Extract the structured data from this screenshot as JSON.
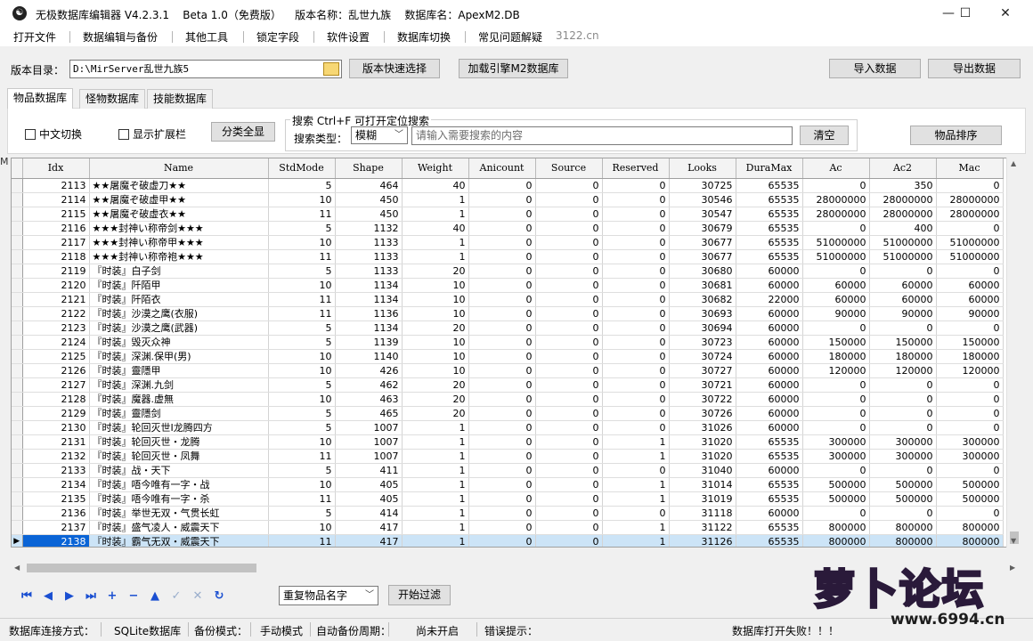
{
  "titlebar": {
    "title": "无极数据库编辑器 V4.2.3.1    Beta 1.0（免费版）    版本名称：乱世九族    数据库名：ApexM2.DB",
    "minimize": "—",
    "maximize": "☐",
    "close": "✕"
  },
  "menu": [
    "打开文件",
    "数据编辑与备份",
    "其他工具",
    "锁定字段",
    "软件设置",
    "数据库切换",
    "常见问题解疑",
    "3122.cn"
  ],
  "toolbar": {
    "version_dir_label": "版本目录：",
    "version_dir_value": "D:\\MirServer乱世九族5",
    "quick_select": "版本快速选择",
    "load_engine_db": "加载引擎M2数据库",
    "import": "导入数据",
    "export": "导出数据"
  },
  "tabs": [
    "物品数据库",
    "怪物数据库",
    "技能数据库"
  ],
  "filters": {
    "chinese_toggle": "中文切换",
    "show_ext": "显示扩展栏",
    "show_all_categories": "分类全显",
    "search_title": "搜索  Ctrl+F 可打开定位搜索",
    "search_type_label": "搜索类型：",
    "search_type_value": "模糊",
    "search_placeholder": "请输入需要搜索的内容",
    "clear": "清空",
    "sort": "物品排序"
  },
  "grid": {
    "columns": [
      "Idx",
      "Name",
      "StdMode",
      "Shape",
      "Weight",
      "Anicount",
      "Source",
      "Reserved",
      "Looks",
      "DuraMax",
      "Ac",
      "Ac2",
      "Mac"
    ],
    "selected_indicator": "▶",
    "rows": [
      [
        "2113",
        "★★屠魔ぞ破虚刀★★",
        "5",
        "464",
        "40",
        "0",
        "0",
        "0",
        "30725",
        "65535",
        "0",
        "350",
        "0"
      ],
      [
        "2114",
        "★★屠魔ぞ破虚甲★★",
        "10",
        "450",
        "1",
        "0",
        "0",
        "0",
        "30546",
        "65535",
        "28000000",
        "28000000",
        "28000000"
      ],
      [
        "2115",
        "★★屠魔ぞ破虚衣★★",
        "11",
        "450",
        "1",
        "0",
        "0",
        "0",
        "30547",
        "65535",
        "28000000",
        "28000000",
        "28000000"
      ],
      [
        "2116",
        "★★★封神い称帝剑★★★",
        "5",
        "1132",
        "40",
        "0",
        "0",
        "0",
        "30679",
        "65535",
        "0",
        "400",
        "0"
      ],
      [
        "2117",
        "★★★封神い称帝甲★★★",
        "10",
        "1133",
        "1",
        "0",
        "0",
        "0",
        "30677",
        "65535",
        "51000000",
        "51000000",
        "51000000"
      ],
      [
        "2118",
        "★★★封神い称帝袍★★★",
        "11",
        "1133",
        "1",
        "0",
        "0",
        "0",
        "30677",
        "65535",
        "51000000",
        "51000000",
        "51000000"
      ],
      [
        "2119",
        "『时装』白子剑",
        "5",
        "1133",
        "20",
        "0",
        "0",
        "0",
        "30680",
        "60000",
        "0",
        "0",
        "0"
      ],
      [
        "2120",
        "『时装』阡陌甲",
        "10",
        "1134",
        "10",
        "0",
        "0",
        "0",
        "30681",
        "60000",
        "60000",
        "60000",
        "60000"
      ],
      [
        "2121",
        "『时装』阡陌衣",
        "11",
        "1134",
        "10",
        "0",
        "0",
        "0",
        "30682",
        "22000",
        "60000",
        "60000",
        "60000"
      ],
      [
        "2122",
        "『时装』沙漠之鹰(衣服)",
        "11",
        "1136",
        "10",
        "0",
        "0",
        "0",
        "30693",
        "60000",
        "90000",
        "90000",
        "90000"
      ],
      [
        "2123",
        "『时装』沙漠之鹰(武器)",
        "5",
        "1134",
        "20",
        "0",
        "0",
        "0",
        "30694",
        "60000",
        "0",
        "0",
        "0"
      ],
      [
        "2124",
        "『时装』毁灭众神",
        "5",
        "1139",
        "10",
        "0",
        "0",
        "0",
        "30723",
        "60000",
        "150000",
        "150000",
        "150000"
      ],
      [
        "2125",
        "『时装』深渊.保甲(男)",
        "10",
        "1140",
        "10",
        "0",
        "0",
        "0",
        "30724",
        "60000",
        "180000",
        "180000",
        "180000"
      ],
      [
        "2126",
        "『时装』靈隱甲",
        "10",
        "426",
        "10",
        "0",
        "0",
        "0",
        "30727",
        "60000",
        "120000",
        "120000",
        "120000"
      ],
      [
        "2127",
        "『时装』深渊.九剑",
        "5",
        "462",
        "20",
        "0",
        "0",
        "0",
        "30721",
        "60000",
        "0",
        "0",
        "0"
      ],
      [
        "2128",
        "『时装』魔器.虚無",
        "10",
        "463",
        "20",
        "0",
        "0",
        "0",
        "30722",
        "60000",
        "0",
        "0",
        "0"
      ],
      [
        "2129",
        "『时装』靈隱剑",
        "5",
        "465",
        "20",
        "0",
        "0",
        "0",
        "30726",
        "60000",
        "0",
        "0",
        "0"
      ],
      [
        "2130",
        "『时装』轮回灭世I龙腾四方",
        "5",
        "1007",
        "1",
        "0",
        "0",
        "0",
        "31026",
        "60000",
        "0",
        "0",
        "0"
      ],
      [
        "2131",
        "『时装』轮回灭世・龙腾",
        "10",
        "1007",
        "1",
        "0",
        "0",
        "1",
        "31020",
        "65535",
        "300000",
        "300000",
        "300000"
      ],
      [
        "2132",
        "『时装』轮回灭世・凤舞",
        "11",
        "1007",
        "1",
        "0",
        "0",
        "1",
        "31020",
        "65535",
        "300000",
        "300000",
        "300000"
      ],
      [
        "2133",
        "『时装』战・天下",
        "5",
        "411",
        "1",
        "0",
        "0",
        "0",
        "31040",
        "60000",
        "0",
        "0",
        "0"
      ],
      [
        "2134",
        "『时装』唔今唯有一字・战",
        "10",
        "405",
        "1",
        "0",
        "0",
        "1",
        "31014",
        "65535",
        "500000",
        "500000",
        "500000"
      ],
      [
        "2135",
        "『时装』唔今唯有一字・杀",
        "11",
        "405",
        "1",
        "0",
        "0",
        "1",
        "31019",
        "65535",
        "500000",
        "500000",
        "500000"
      ],
      [
        "2136",
        "『时装』举世无双・气贯长虹",
        "5",
        "414",
        "1",
        "0",
        "0",
        "0",
        "31118",
        "60000",
        "0",
        "0",
        "0"
      ],
      [
        "2137",
        "『时装』盛气凌人・威震天下",
        "10",
        "417",
        "1",
        "0",
        "0",
        "1",
        "31122",
        "65535",
        "800000",
        "800000",
        "800000"
      ],
      [
        "2138",
        "『时装』霸气无双・威震天下",
        "11",
        "417",
        "1",
        "0",
        "0",
        "1",
        "31126",
        "65535",
        "800000",
        "800000",
        "800000"
      ]
    ]
  },
  "bottom": {
    "filter_select": "重复物品名字",
    "start_filter": "开始过滤"
  },
  "status": {
    "conn_label": "数据库连接方式：",
    "conn_value": "SQLite数据库",
    "backup_label": "备份模式：",
    "backup_value": "手动模式",
    "auto_label": "自动备份周期：",
    "auto_value": "尚未开启",
    "error_label": "错误提示：",
    "error_value": "数据库打开失败！！！"
  },
  "logo": {
    "text": "萝卜论坛",
    "url": "www.6994.cn"
  },
  "left_mark": "M"
}
